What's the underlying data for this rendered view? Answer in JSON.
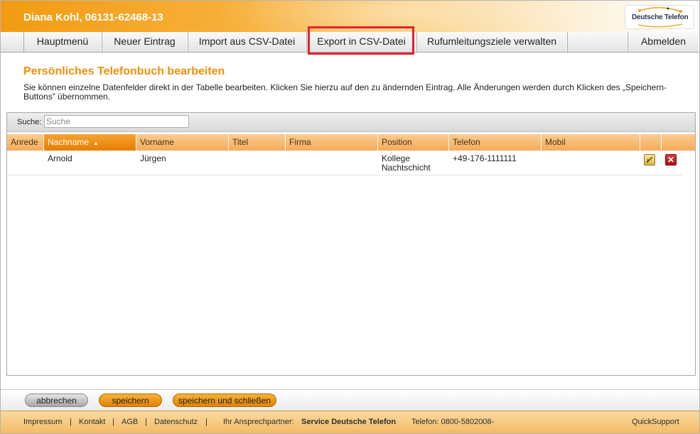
{
  "header": {
    "user_title": "Diana Kohl, 06131-62468-13",
    "logo_text": "Deutsche Telefon"
  },
  "nav": {
    "items": [
      "Hauptmenü",
      "Neuer Eintrag",
      "Import aus CSV-Datei",
      "Export in CSV-Datei",
      "Rufumleitungsziele verwalten",
      "",
      "Abmelden"
    ],
    "highlighted": "Export in CSV-Datei"
  },
  "page": {
    "title": "Persönliches Telefonbuch bearbeiten",
    "description": "Sie können einzelne Datenfelder direkt in der Tabelle bearbeiten. Klicken Sie hierzu auf den zu ändernden Eintrag. Alle Änderungen werden durch Klicken des „Speichern-Buttons” übernommen."
  },
  "search": {
    "label": "Suche:",
    "placeholder": "Suche",
    "value": ""
  },
  "table": {
    "columns": [
      "Anrede",
      "Nachname",
      "Vorname",
      "Titel",
      "Firma",
      "Position",
      "Telefon",
      "Mobil",
      "",
      ""
    ],
    "sorted_column": "Nachname",
    "sort_arrow": "▲",
    "rows": [
      {
        "anrede": "",
        "nachname": "Arnold",
        "vorname": "Jürgen",
        "titel": "",
        "firma": "",
        "position": "Kollege Nachtschicht",
        "telefon": "+49-176-1111111",
        "mobil": "",
        "edit_icon": "edit-icon",
        "delete_icon": "close-icon",
        "delete_glyph": "✕"
      }
    ]
  },
  "buttons": {
    "cancel": "abbrechen",
    "save": "speichern",
    "save_close": "speichern und schließen"
  },
  "footer": {
    "impressum": "Impressum",
    "kontakt": "Kontakt",
    "agb": "AGB",
    "datenschutz": "Datenschutz",
    "separator": "|",
    "contact_label": "Ihr Ansprechpartner:",
    "contact_name": "Service Deutsche Telefon",
    "phone": "Telefon: 0800-5802008-",
    "quicksupport": "QuickSupport"
  },
  "colors": {
    "accent": "#f0900a",
    "highlight_border": "#e0242e",
    "header_orange": "#f29b12"
  }
}
